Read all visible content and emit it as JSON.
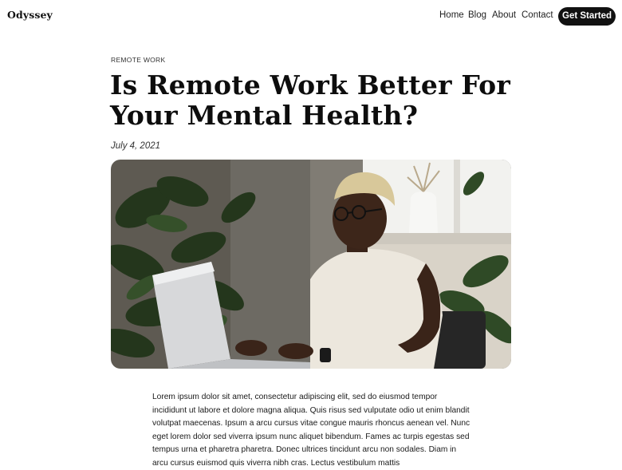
{
  "site": {
    "logo": "Odyssey"
  },
  "nav": {
    "home": "Home",
    "blog": "Blog",
    "about": "About",
    "contact": "Contact",
    "cta": "Get Started"
  },
  "article": {
    "category": "REMOTE WORK",
    "title": "Is Remote Work Better For Your Mental Health?",
    "date": "July 4, 2021",
    "body": "Lorem ipsum dolor sit amet, consectetur adipiscing elit, sed do eiusmod tempor incididunt ut labore et dolore magna aliqua. Quis risus sed vulputate odio ut enim blandit volutpat maecenas. Ipsum a arcu cursus vitae congue mauris rhoncus aenean vel. Nunc eget lorem dolor sed viverra ipsum nunc aliquet bibendum. Fames ac turpis egestas sed tempus urna et pharetra pharetra. Donec ultrices tincidunt arcu non sodales. Diam in arcu cursus euismod quis viverra nibh cras. Lectus vestibulum mattis"
  },
  "colors": {
    "accent": "#111111",
    "background": "#ffffff"
  }
}
